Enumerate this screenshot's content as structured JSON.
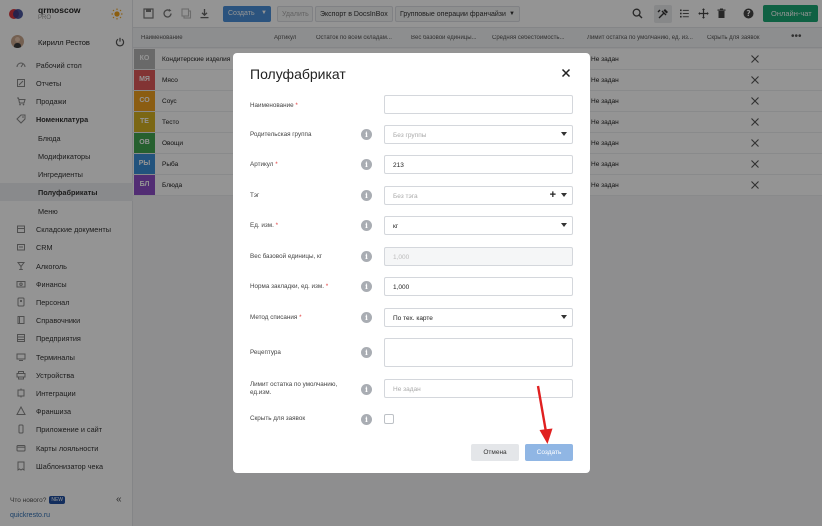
{
  "brand": {
    "name": "qrmoscow",
    "plan": "PRO"
  },
  "user": {
    "name": "Кирилл Рестов"
  },
  "sidebar": {
    "items": [
      {
        "label": "Рабочий стол",
        "icon": "dashboard-icon"
      },
      {
        "label": "Отчеты",
        "icon": "reports-icon"
      },
      {
        "label": "Продажи",
        "icon": "cart-icon"
      },
      {
        "label": "Номенклатура",
        "icon": "tag-icon"
      },
      {
        "label": "Блюда"
      },
      {
        "label": "Модификаторы"
      },
      {
        "label": "Ингредиенты"
      },
      {
        "label": "Полуфабрикаты"
      },
      {
        "label": "Меню"
      },
      {
        "label": "Складские документы",
        "icon": "warehouse-icon"
      },
      {
        "label": "CRM",
        "icon": "crm-icon"
      },
      {
        "label": "Алкоголь",
        "icon": "glass-icon"
      },
      {
        "label": "Финансы",
        "icon": "finance-icon"
      },
      {
        "label": "Персонал",
        "icon": "staff-icon"
      },
      {
        "label": "Справочники",
        "icon": "book-icon"
      },
      {
        "label": "Предприятия",
        "icon": "building-icon"
      },
      {
        "label": "Терминалы",
        "icon": "terminal-icon"
      },
      {
        "label": "Устройства",
        "icon": "printer-icon"
      },
      {
        "label": "Интеграции",
        "icon": "integration-icon"
      },
      {
        "label": "Франшиза",
        "icon": "franchise-icon"
      },
      {
        "label": "Приложение и сайт",
        "icon": "app-icon"
      },
      {
        "label": "Карты лояльности",
        "icon": "card-icon"
      },
      {
        "label": "Шаблонизатор чека",
        "icon": "receipt-icon"
      }
    ],
    "whats_new": "Что нового?",
    "new_badge": "NEW",
    "site_link": "quickresto.ru"
  },
  "toolbar": {
    "create": "Создать",
    "delete": "Удалить",
    "export": "Экспорт в DocsInBox",
    "group_ops": "Групповые операции франчайзи",
    "chat": "Онлайн-чат"
  },
  "table": {
    "columns": [
      "Наименование",
      "Артикул",
      "Остаток по всем складам...",
      "Вес базовой единицы...",
      "Средняя себестоимость...",
      "Лимит остатка по умолчанию, ед. из...",
      "Скрыть для заявок"
    ],
    "rows": [
      {
        "abbr": "КО",
        "name": "Кондитерские изделия",
        "color": "#b5b5b5",
        "limit": "Не задан"
      },
      {
        "abbr": "МЯ",
        "name": "Мясо",
        "color": "#e05a5a",
        "limit": "Не задан"
      },
      {
        "abbr": "СО",
        "name": "Соус",
        "color": "#f0a020",
        "limit": "Не задан"
      },
      {
        "abbr": "ТЕ",
        "name": "Тесто",
        "color": "#d4b224",
        "limit": "Не задан"
      },
      {
        "abbr": "ОВ",
        "name": "Овощи",
        "color": "#42a552",
        "limit": "Не задан"
      },
      {
        "abbr": "РЫ",
        "name": "Рыба",
        "color": "#3c8fd8",
        "limit": "Не задан"
      },
      {
        "abbr": "БЛ",
        "name": "Блюда",
        "color": "#8d4fc8",
        "limit": "Не задан"
      }
    ]
  },
  "modal": {
    "title": "Полуфабрикат",
    "fields": {
      "name": {
        "label": "Наименование",
        "required": "*",
        "value": ""
      },
      "parent": {
        "label": "Родительская группа",
        "value": "Без группы"
      },
      "article": {
        "label": "Артикул",
        "required": "*",
        "value": "213"
      },
      "tag": {
        "label": "Тэг",
        "value": "Без тэга"
      },
      "unit": {
        "label": "Ед. изм.",
        "required": "*",
        "value": "кг"
      },
      "weight": {
        "label": "Вес базовой единицы, кг",
        "value": "1,000"
      },
      "norm": {
        "label": "Норма закладки, ед. изм.",
        "required": "*",
        "value": "1,000"
      },
      "method": {
        "label": "Метод списания",
        "required": "*",
        "value": "По тех. карте"
      },
      "recipe": {
        "label": "Рецептура",
        "value": ""
      },
      "limit": {
        "label": "Лимит остатка по умолчанию, ед.изм.",
        "value": "Не задан"
      },
      "hide": {
        "label": "Скрыть для заявок"
      }
    },
    "cancel": "Отмена",
    "submit": "Создать"
  },
  "colors": {
    "primary": "#4a90d9",
    "chat": "#1aa774",
    "arrow": "#e02020"
  }
}
